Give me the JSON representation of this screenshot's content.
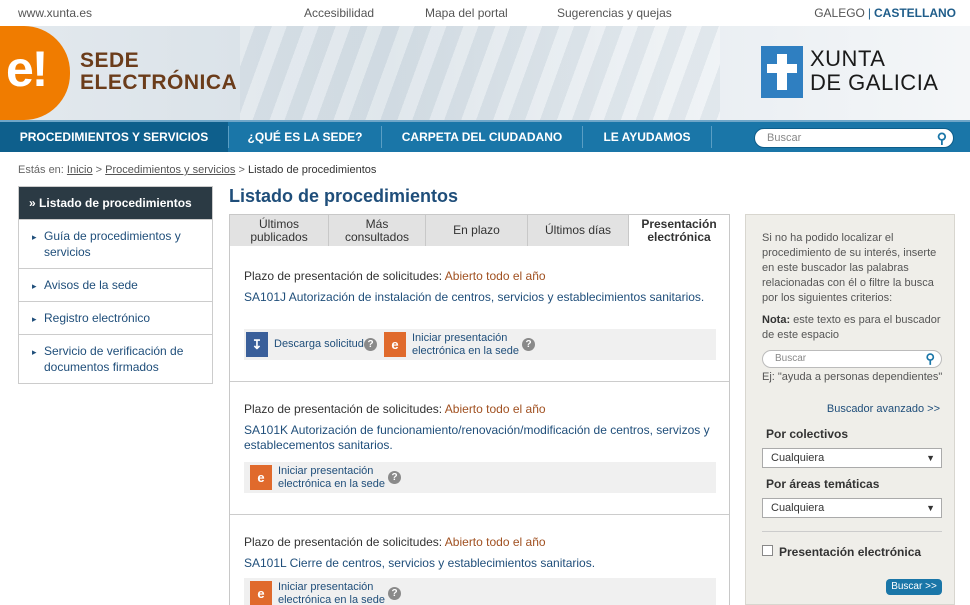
{
  "topbar": {
    "site": "www.xunta.es",
    "links": [
      "Accesibilidad",
      "Mapa del portal",
      "Sugerencias y quejas"
    ],
    "lang_galego": "GALEGO",
    "lang_sep": "|",
    "lang_castellano": "CASTELLANO"
  },
  "header": {
    "logo_mark": "e!",
    "logo_line1": "SEDE",
    "logo_line2": "ELECTRÓNICA",
    "xunta_line1": "XUNTA",
    "xunta_line2": "DE GALICIA"
  },
  "nav": {
    "items": [
      "PROCEDIMIENTOS Y SERVICIOS",
      "¿QUÉ ES LA SEDE?",
      "CARPETA DEL CIUDADANO",
      "LE AYUDAMOS"
    ],
    "search_placeholder": "Buscar"
  },
  "breadcrumb": {
    "prefix": "Estás en:",
    "inicio": "Inicio",
    "sep": ">",
    "procedimientos": "Procedimientos y servicios",
    "current": "Listado de procedimientos"
  },
  "sidebar": {
    "head": "Listado de procedimientos",
    "head_icon": "»",
    "items": [
      "Guía de procedimientos y servicios",
      "Avisos de la sede",
      "Registro electrónico",
      "Servicio de verificación de documentos firmados"
    ]
  },
  "main": {
    "title": "Listado de procedimientos",
    "tabs": [
      {
        "l1": "Últimos",
        "l2": "publicados"
      },
      {
        "l1": "Más",
        "l2": "consultados"
      },
      {
        "l1": "En plazo",
        "l2": ""
      },
      {
        "l1": "Últimos días",
        "l2": ""
      },
      {
        "l1": "Presentación",
        "l2": "electrónica"
      }
    ],
    "plazo_label": "Plazo de presentación de solicitudes:",
    "plazo_value": "Abierto todo el año",
    "descarga": "Descarga solicitud",
    "iniciar_l1": "Iniciar presentación",
    "iniciar_l2": "electrónica en la sede",
    "help": "?",
    "items": [
      {
        "desc": "SA101J Autorización de instalación de centros, servicios y establecimientos sanitarios."
      },
      {
        "desc": "SA101K Autorización de funcionamiento/renovación/modificación de centros, servizos y establecementos sanitarios."
      },
      {
        "desc": "SA101L Cierre de centros, servicios y establecimientos sanitarios."
      }
    ]
  },
  "rpanel": {
    "text": "Si no ha podido localizar el procedimiento de su interés, inserte en este buscador las palabras relacionadas con él o filtre la busca por los siguientes criterios:",
    "nota_label": "Nota:",
    "nota_text": "este texto es para el buscador de este espacio",
    "search_placeholder": "Buscar",
    "ejemplo": "Ej: \"ayuda a personas dependientes\"",
    "avanzado": "Buscador avanzado >>",
    "colectivos_label": "Por colectivos",
    "colectivos_value": "Cualquiera",
    "areas_label": "Por áreas temáticas",
    "areas_value": "Cualquiera",
    "check_label": "Presentación electrónica",
    "button": "Buscar >>"
  }
}
